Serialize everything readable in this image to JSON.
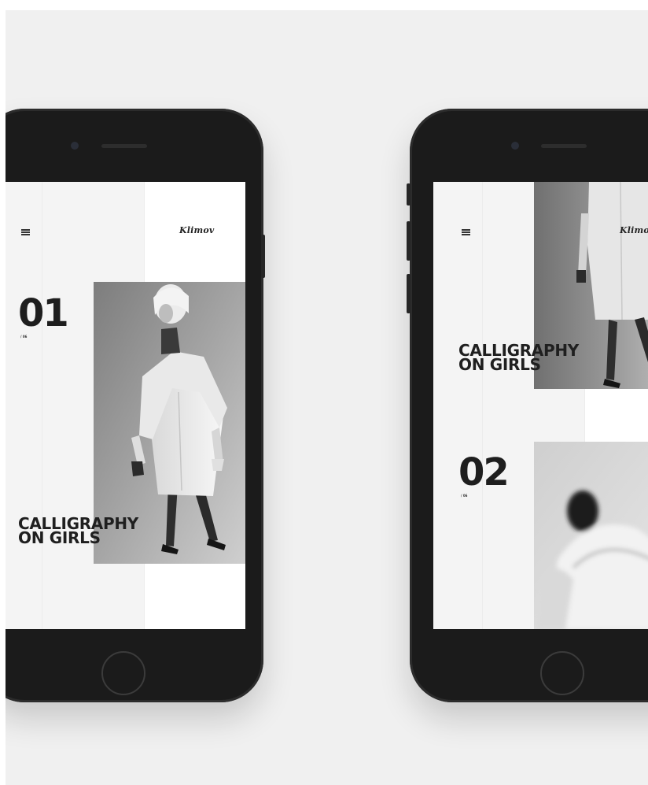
{
  "app": {
    "logo": "Klimov"
  },
  "slides": [
    {
      "number": "01",
      "count": "/ 06",
      "title_line1": "CALLIGRAPHY",
      "title_line2": "ON GIRLS"
    },
    {
      "number": "02",
      "count": "/ 06"
    }
  ],
  "icons": {
    "menu": "hamburger-menu-icon",
    "home_button": "home-button-icon",
    "camera": "camera-icon",
    "speaker": "speaker-icon"
  },
  "colors": {
    "background": "#f0f0f0",
    "phone_body": "#1b1b1b",
    "screen": "#ffffff",
    "text": "#1f1f1f"
  }
}
